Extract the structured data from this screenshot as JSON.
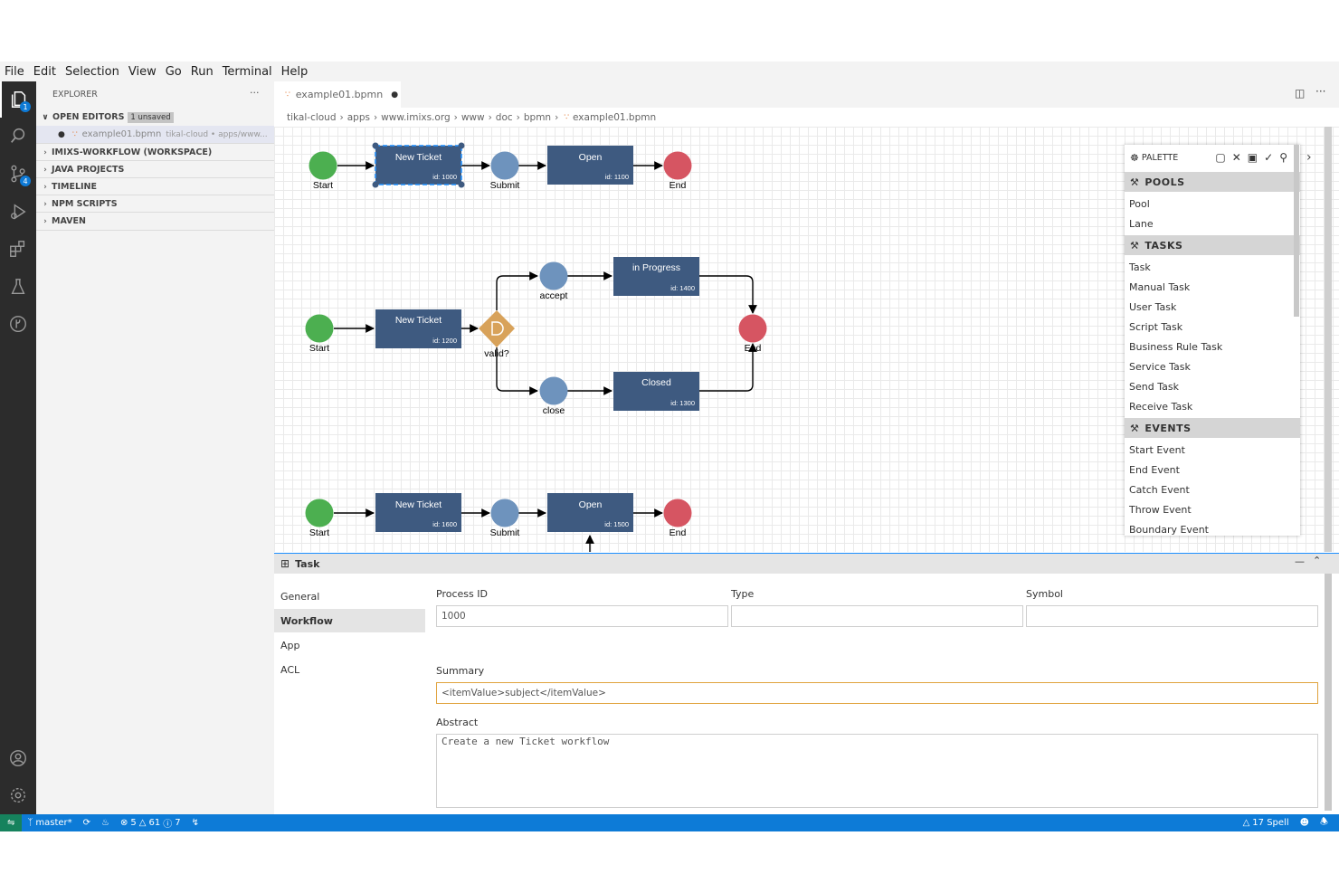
{
  "menu": [
    "File",
    "Edit",
    "Selection",
    "View",
    "Go",
    "Run",
    "Terminal",
    "Help"
  ],
  "activity": {
    "explorer_badge": "1",
    "scm_badge": "4"
  },
  "explorer": {
    "title": "EXPLORER",
    "more": "···",
    "open_editors": "OPEN EDITORS",
    "unsaved_badge": "1 unsaved",
    "open_file_name": "example01.bpmn",
    "open_file_path": "tikal-cloud • apps/www...",
    "sections": [
      "IMIXS-WORKFLOW (WORKSPACE)",
      "JAVA PROJECTS",
      "TIMELINE",
      "NPM SCRIPTS",
      "MAVEN"
    ]
  },
  "tab": {
    "label": "example01.bpmn",
    "dirty": "●"
  },
  "breadcrumb": [
    "tikal-cloud",
    "apps",
    "www.imixs.org",
    "www",
    "doc",
    "bpmn",
    "example01.bpmn"
  ],
  "diagram": {
    "row1": {
      "start": "Start",
      "task1": "New Ticket",
      "task1_id": "id: 1000",
      "event": "Submit",
      "task2": "Open",
      "task2_id": "id: 1100",
      "end": "End"
    },
    "row2": {
      "start": "Start",
      "task1": "New Ticket",
      "task1_id": "id: 1200",
      "gateway": "valid?",
      "accept": "accept",
      "close": "close",
      "progress": "in Progress",
      "progress_id": "id: 1400",
      "closed": "Closed",
      "closed_id": "id: 1300",
      "end": "End"
    },
    "row3": {
      "start": "Start",
      "task1": "New Ticket",
      "task1_id": "id: 1600",
      "event": "Submit",
      "task2": "Open",
      "task2_id": "id: 1500",
      "end": "End"
    },
    "colors": {
      "start": "#4caf50",
      "end": "#d65562",
      "event": "#6e93bd",
      "task": "#3e5a80",
      "gateway": "#d8a25a"
    }
  },
  "palette": {
    "title": "PALETTE",
    "groups": [
      {
        "name": "POOLS",
        "items": [
          "Pool",
          "Lane"
        ]
      },
      {
        "name": "TASKS",
        "items": [
          "Task",
          "Manual Task",
          "User Task",
          "Script Task",
          "Business Rule Task",
          "Service Task",
          "Send Task",
          "Receive Task"
        ]
      },
      {
        "name": "EVENTS",
        "items": [
          "Start Event",
          "End Event",
          "Catch Event",
          "Throw Event",
          "Boundary Event"
        ]
      }
    ]
  },
  "properties": {
    "title": "Task",
    "tabs": [
      "General",
      "Workflow",
      "App",
      "ACL"
    ],
    "process_id_label": "Process ID",
    "process_id": "1000",
    "type_label": "Type",
    "type_value": "",
    "symbol_label": "Symbol",
    "symbol_value": "",
    "summary_label": "Summary",
    "summary": "<itemValue>subject</itemValue>",
    "abstract_label": "Abstract",
    "abstract": "Create a new Ticket workflow"
  },
  "status": {
    "branch": "master*",
    "errors": "5",
    "warnings": "61",
    "infos": "7",
    "spell": "17 Spell"
  }
}
